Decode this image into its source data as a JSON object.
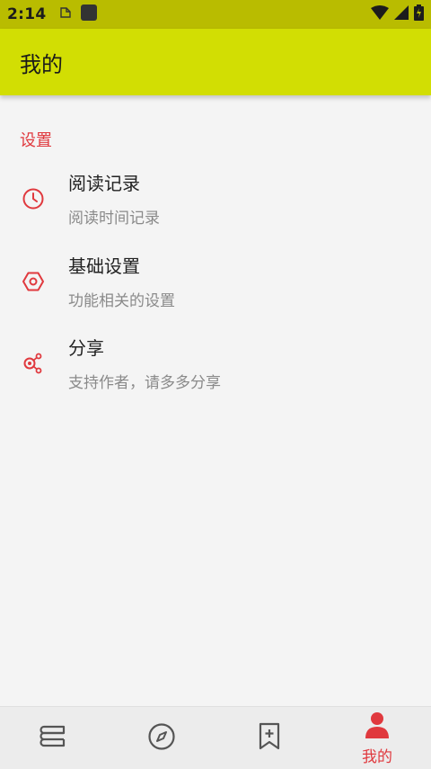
{
  "status_bar": {
    "time": "2:14",
    "icons": [
      "notification-icon",
      "app-icon",
      "wifi-icon",
      "signal-icon",
      "battery-icon"
    ]
  },
  "app_bar": {
    "title": "我的"
  },
  "settings": {
    "header": "设置",
    "items": [
      {
        "title": "阅读记录",
        "subtitle": "阅读时间记录",
        "icon": "clock-icon"
      },
      {
        "title": "基础设置",
        "subtitle": "功能相关的设置",
        "icon": "settings-hexagon-icon"
      },
      {
        "title": "分享",
        "subtitle": "支持作者，请多多分享",
        "icon": "share-icon"
      }
    ]
  },
  "bottom_nav": {
    "items": [
      {
        "icon": "bookshelf-icon",
        "label": ""
      },
      {
        "icon": "compass-icon",
        "label": ""
      },
      {
        "icon": "bookmark-add-icon",
        "label": ""
      },
      {
        "icon": "person-icon",
        "label": "我的",
        "selected": true
      }
    ]
  },
  "colors": {
    "status_bar": "#b9bc00",
    "app_bar": "#d2de03",
    "accent": "#e0393e",
    "background": "#f4f4f4",
    "nav_icon": "#555555"
  }
}
